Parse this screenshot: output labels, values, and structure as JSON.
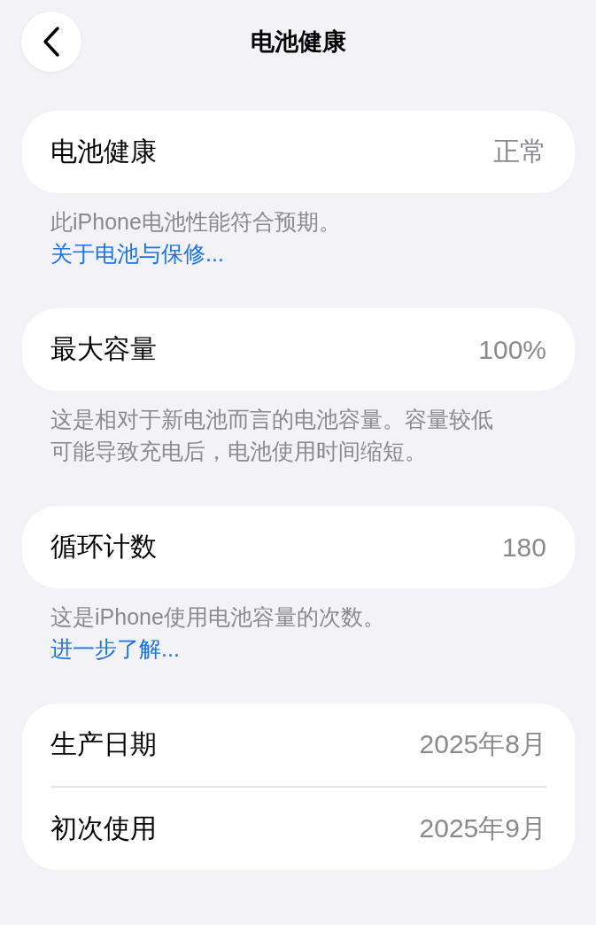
{
  "nav": {
    "title": "电池健康"
  },
  "sections": [
    {
      "rows": [
        {
          "label": "电池健康",
          "value": "正常"
        }
      ],
      "footer": {
        "text": "此iPhone电池性能符合预期。",
        "link": "关于电池与保修..."
      }
    },
    {
      "rows": [
        {
          "label": "最大容量",
          "value": "100%"
        }
      ],
      "footer": {
        "text": "这是相对于新电池而言的电池容量。容量较低可能导致充电后，电池使用时间缩短。"
      }
    },
    {
      "rows": [
        {
          "label": "循环计数",
          "value": "180"
        }
      ],
      "footer": {
        "text": "这是iPhone使用电池容量的次数。",
        "link": "进一步了解..."
      }
    },
    {
      "rows": [
        {
          "label": "生产日期",
          "value": "2025年8月"
        },
        {
          "label": "初次使用",
          "value": "2025年9月"
        }
      ]
    }
  ]
}
